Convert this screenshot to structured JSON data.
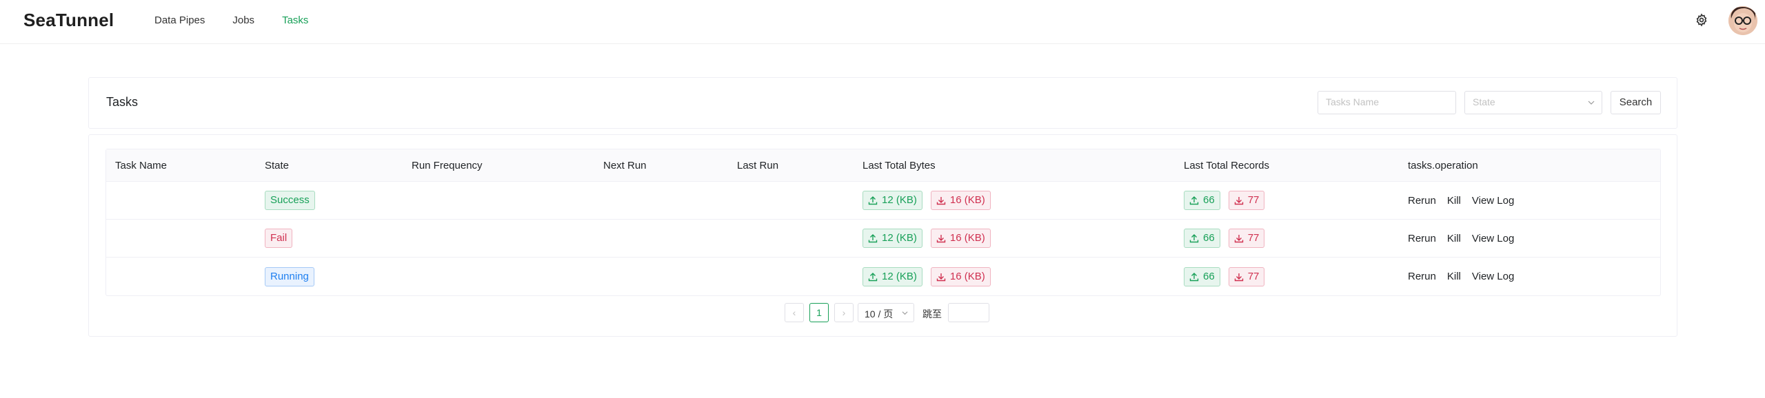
{
  "app": {
    "title": "SeaTunnel"
  },
  "nav": [
    {
      "label": "Data Pipes",
      "active": false
    },
    {
      "label": "Jobs",
      "active": false
    },
    {
      "label": "Tasks",
      "active": true
    }
  ],
  "icons": {
    "settings": "gear-icon",
    "avatar": "user-avatar",
    "upload": "upload-icon",
    "download": "download-icon"
  },
  "colors": {
    "accent": "#18a058",
    "error": "#d03050",
    "info": "#2080f0"
  },
  "search": {
    "title": "Tasks",
    "name_placeholder": "Tasks Name",
    "state_placeholder": "State",
    "button": "Search"
  },
  "table": {
    "columns": [
      "Task Name",
      "State",
      "Run Frequency",
      "Next Run",
      "Last Run",
      "Last Total Bytes",
      "Last Total Records",
      "tasks.operation"
    ],
    "rows": [
      {
        "task_name": "",
        "state": "Success",
        "run_frequency": "",
        "next_run": "",
        "last_run": "",
        "bytes_up": "12 (KB)",
        "bytes_down": "16 (KB)",
        "records_up": "66",
        "records_down": "77",
        "ops": [
          "Rerun",
          "Kill",
          "View Log"
        ]
      },
      {
        "task_name": "",
        "state": "Fail",
        "run_frequency": "",
        "next_run": "",
        "last_run": "",
        "bytes_up": "12 (KB)",
        "bytes_down": "16 (KB)",
        "records_up": "66",
        "records_down": "77",
        "ops": [
          "Rerun",
          "Kill",
          "View Log"
        ]
      },
      {
        "task_name": "",
        "state": "Running",
        "run_frequency": "",
        "next_run": "",
        "last_run": "",
        "bytes_up": "12 (KB)",
        "bytes_down": "16 (KB)",
        "records_up": "66",
        "records_down": "77",
        "ops": [
          "Rerun",
          "Kill",
          "View Log"
        ]
      }
    ]
  },
  "pagination": {
    "prev": "‹",
    "current_page": "1",
    "next": "›",
    "page_size": "10 / 页",
    "jump_label": "跳至",
    "jump_value": ""
  }
}
